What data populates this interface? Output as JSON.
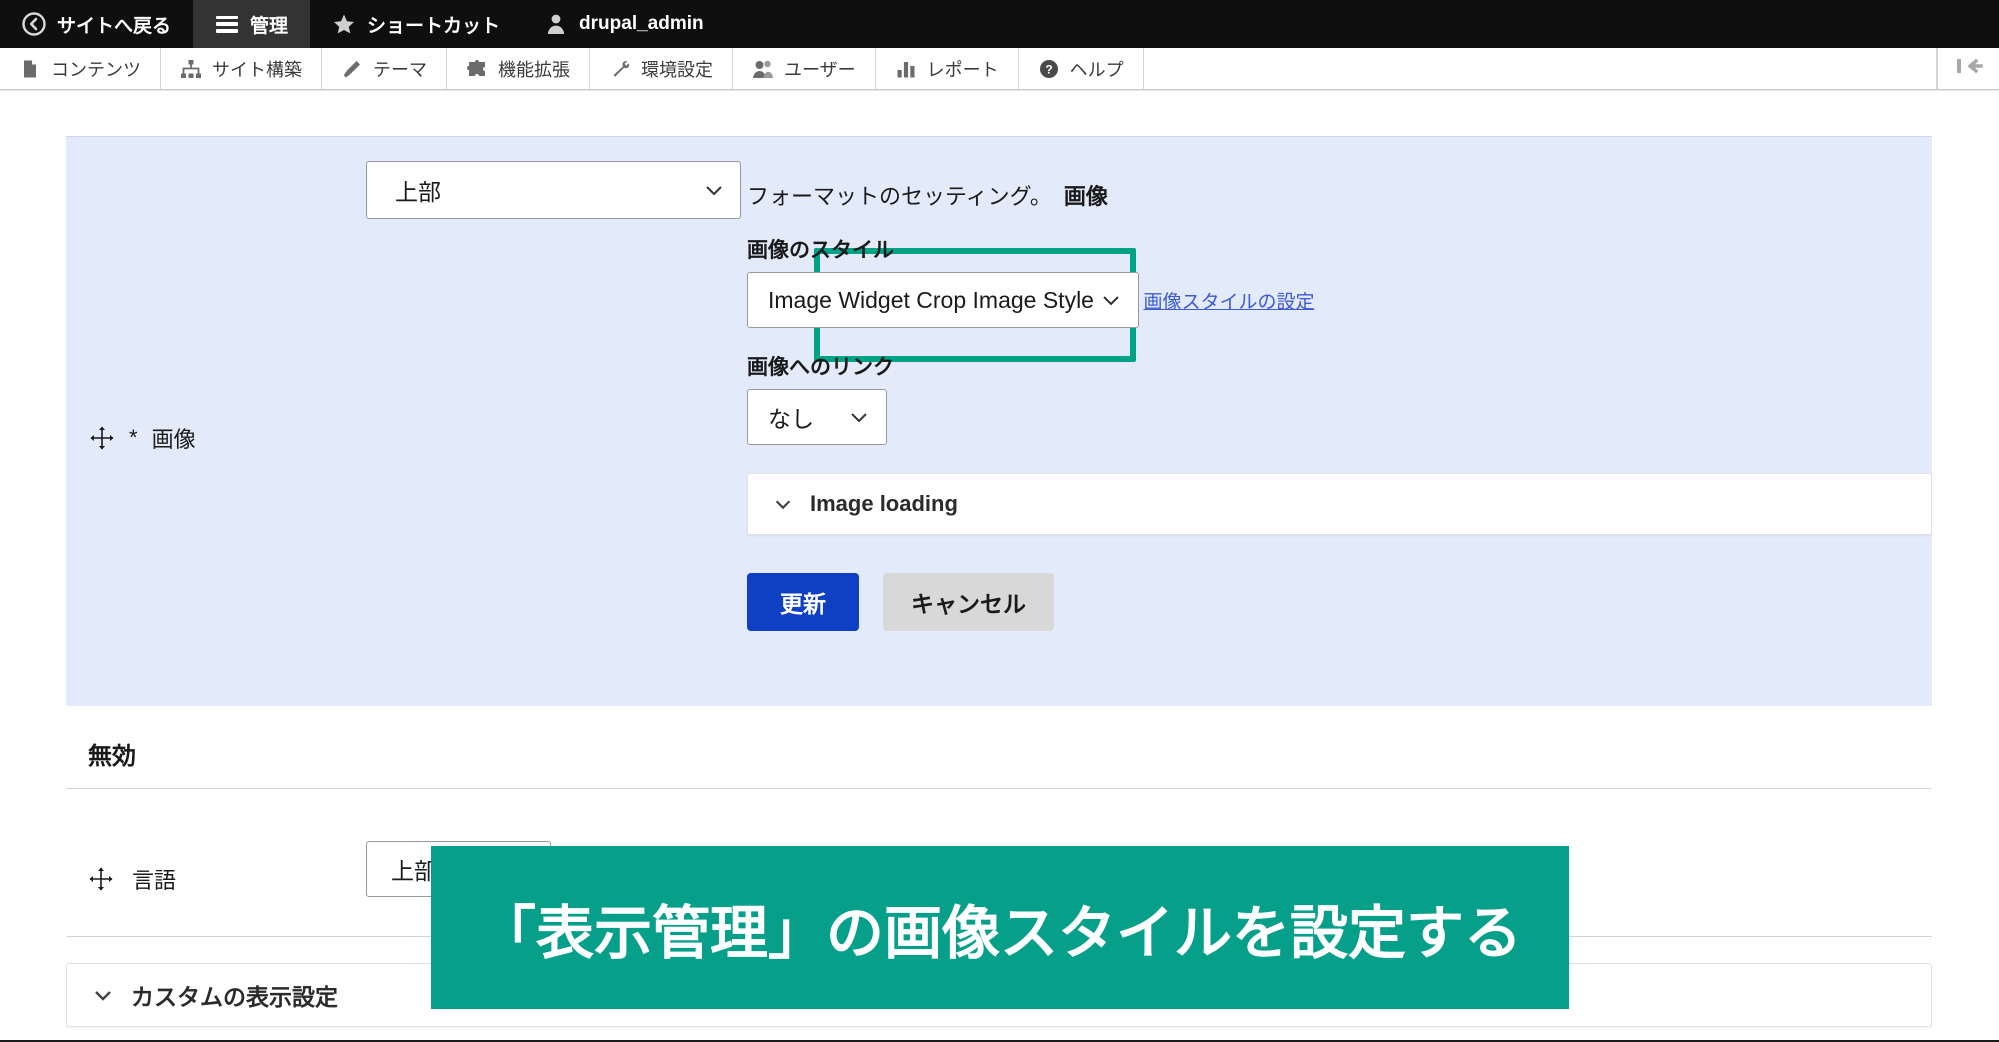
{
  "admin_bar": {
    "items": [
      {
        "label": "サイトへ戻る",
        "icon": "back-circle-icon",
        "active": false
      },
      {
        "label": "管理",
        "icon": "hamburger-icon",
        "active": true
      },
      {
        "label": "ショートカット",
        "icon": "star-icon",
        "active": false
      },
      {
        "label": "drupal_admin",
        "icon": "user-icon",
        "active": false
      }
    ]
  },
  "toolbar": {
    "items": [
      {
        "label": "コンテンツ",
        "icon": "document-icon"
      },
      {
        "label": "サイト構築",
        "icon": "sitemap-icon"
      },
      {
        "label": "テーマ",
        "icon": "brush-icon"
      },
      {
        "label": "機能拡張",
        "icon": "puzzle-icon"
      },
      {
        "label": "環境設定",
        "icon": "wrench-icon"
      },
      {
        "label": "ユーザー",
        "icon": "people-icon"
      },
      {
        "label": "レポート",
        "icon": "bar-chart-icon"
      },
      {
        "label": "ヘルプ",
        "icon": "question-circle-icon"
      }
    ],
    "collapse_icon": "collapse-left-icon"
  },
  "main": {
    "active_field": {
      "label": "画像",
      "required_marker": "*",
      "drag_icon": "drag-move-icon",
      "region_select": {
        "value": "上部",
        "chevron": "chevron-down-icon"
      }
    },
    "format_settings": {
      "prefix": "フォーマットのセッティング。",
      "name": "画像",
      "image_style": {
        "label": "画像のスタイル",
        "value": "Image Widget Crop Image Style",
        "chevron": "chevron-down-icon",
        "config_link": "画像スタイルの設定",
        "highlight_color": "#00a385"
      },
      "image_link": {
        "label": "画像へのリンク",
        "value": "なし",
        "chevron": "chevron-down-icon"
      },
      "image_loading": {
        "label": "Image loading",
        "chevron": "chevron-down-icon"
      },
      "buttons": {
        "update": "更新",
        "cancel": "キャンセル",
        "update_color": "#0f40c4",
        "cancel_color": "#d8d8d8"
      }
    },
    "disabled_section": {
      "heading": "無効"
    },
    "language_row": {
      "label": "言語",
      "drag_icon": "drag-move-icon",
      "region_select": {
        "value": "上部",
        "chevron": "chevron-down-icon"
      }
    },
    "custom_display": {
      "label": "カスタムの表示設定",
      "chevron": "chevron-down-icon"
    }
  },
  "annotation": {
    "text": "「表示管理」の画像スタイルを設定する",
    "background": "#06a08a",
    "text_color": "#ffffff"
  }
}
